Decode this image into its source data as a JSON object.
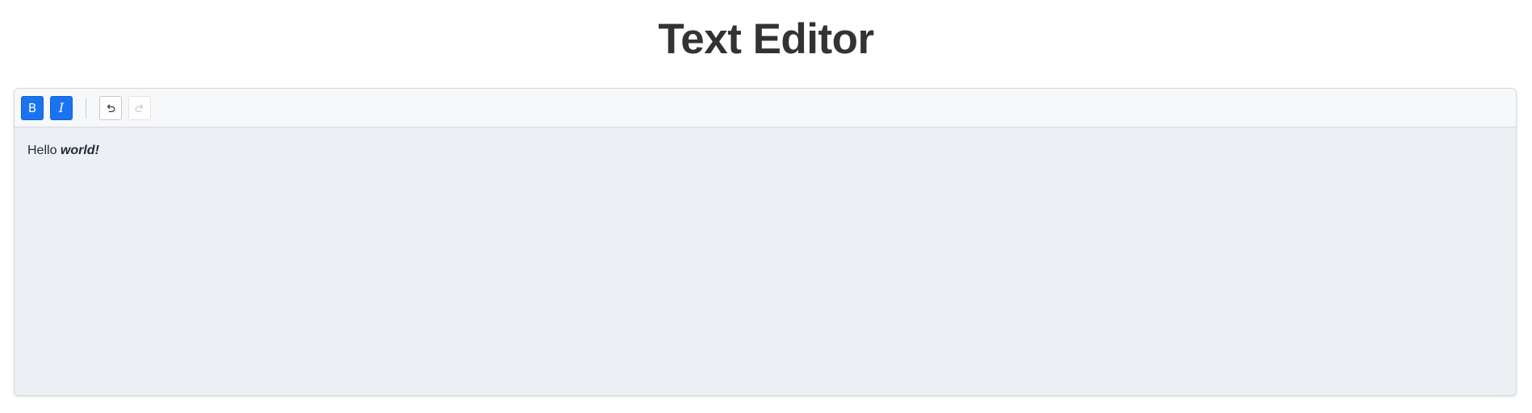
{
  "page": {
    "title": "Text Editor"
  },
  "toolbar": {
    "bold": {
      "label": "B",
      "icon": "bold-icon",
      "active": true
    },
    "italic": {
      "label": "I",
      "icon": "italic-icon",
      "active": true
    },
    "undo": {
      "icon": "undo-icon",
      "enabled": true
    },
    "redo": {
      "icon": "redo-icon",
      "enabled": false
    }
  },
  "editor": {
    "text_plain": "Hello ",
    "text_bold_italic": "world!"
  },
  "colors": {
    "accent": "#1a73f0",
    "toolbar_bg": "#f7f8fa",
    "editor_bg": "#eceff4",
    "title": "#333333"
  }
}
